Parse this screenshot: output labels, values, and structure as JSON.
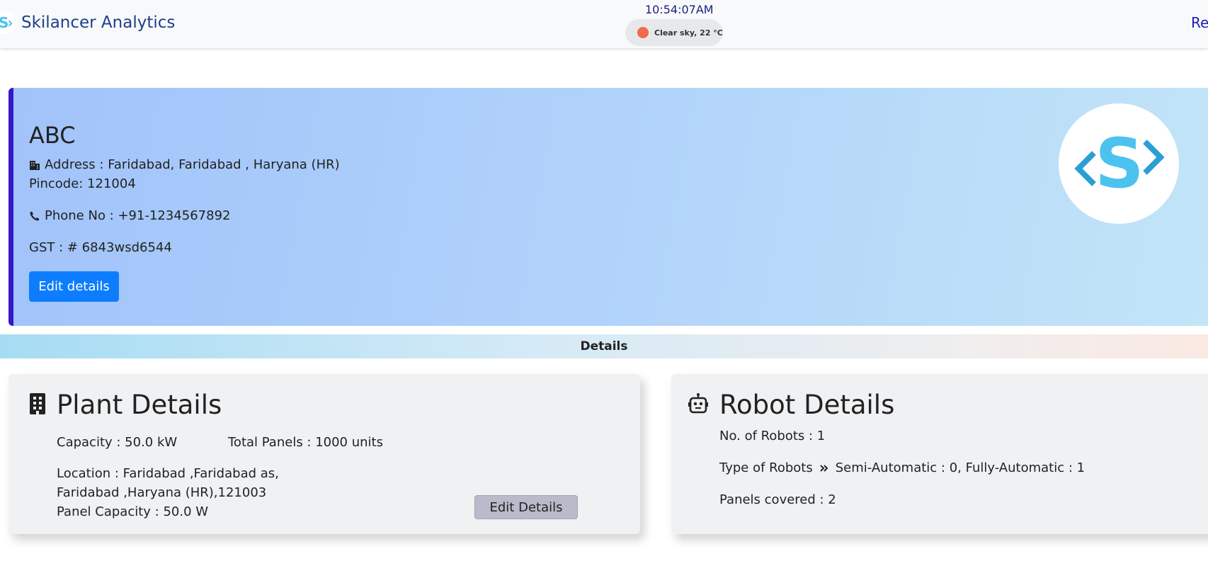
{
  "navbar": {
    "brand_logo_text": "S›",
    "brand_name": "Skilancer Analytics",
    "time": "10:54:07AM",
    "weather": "Clear sky, 22 °C",
    "right_link": "Re"
  },
  "company": {
    "name": "ABC",
    "address": "Address : Faridabad, Faridabad , Haryana (HR)",
    "pincode": "Pincode: 121004",
    "phone": "Phone No : +91-1234567892",
    "gst": "GST : # 6843wsd6544",
    "edit_label": "Edit details"
  },
  "details_heading": "Details",
  "plant": {
    "title": "Plant Details",
    "capacity": "Capacity : 50.0 kW",
    "total_panels": "Total Panels : 1000 units",
    "location_line1": "Location : Faridabad ,Faridabad as,",
    "location_line2": "Faridabad ,Haryana (HR),121003",
    "panel_capacity": "Panel Capacity : 50.0 W",
    "edit_label": "Edit Details"
  },
  "robot": {
    "title": "Robot Details",
    "count": "No. of Robots : 1",
    "type_label": "Type of Robots",
    "type_value": "Semi-Automatic : 0, Fully-Automatic : 1",
    "panels_covered": "Panels covered : 2"
  },
  "colors": {
    "primary": "#0d7dfd",
    "accent_border": "#3418c9",
    "logo_blue": "#4cc2ee",
    "weather_dot": "#ee6b4d"
  },
  "icons": [
    "building-icon",
    "phone-icon",
    "office-building-icon",
    "robot-icon",
    "double-chevron-right-icon",
    "weather-icon"
  ]
}
